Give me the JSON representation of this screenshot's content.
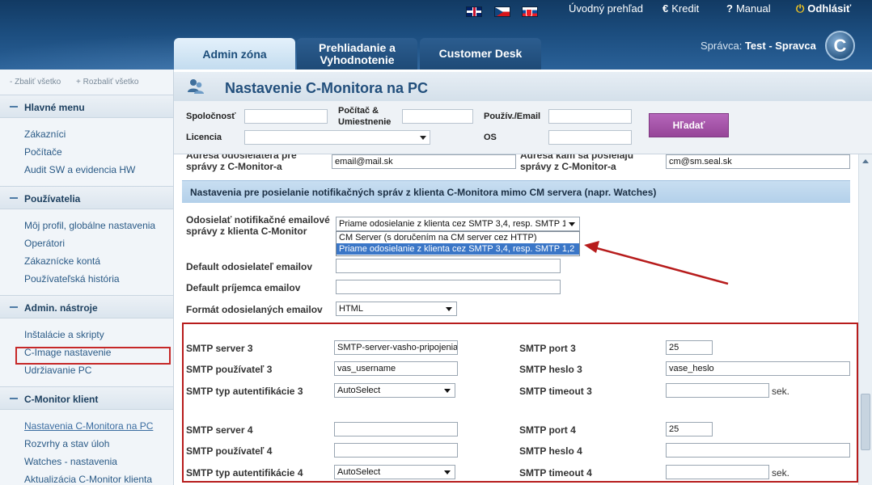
{
  "header": {
    "flags": [
      "en-flag",
      "cz-flag",
      "sk-flag"
    ],
    "links": {
      "home": "Úvodný prehľad",
      "credit": "Kredit",
      "manual": "Manual",
      "logout": "Odhlásiť"
    },
    "tabs": {
      "admin": "Admin zóna",
      "review": "Prehliadanie a Vyhodnotenie",
      "desk": "Customer Desk"
    },
    "admin_label": "Správca:",
    "admin_name": "Test - Spravca",
    "logo_letter": "C"
  },
  "sidebar": {
    "collapse_all": "- Zbaliť všetko",
    "expand_all": "+ Rozbaliť všetko",
    "groups": [
      {
        "title": "Hlavné menu",
        "items": [
          "Zákazníci",
          "Počítače",
          "Audit SW a evidencia HW"
        ]
      },
      {
        "title": "Používatelia",
        "items": [
          "Môj profil, globálne nastavenia",
          "Operátori",
          "Zákaznícke kontá",
          "Používateľská história"
        ]
      },
      {
        "title": "Admin. nástroje",
        "items": [
          "Inštalácie a skripty",
          "C-Image nastavenie",
          "Udržiavanie PC"
        ]
      },
      {
        "title": "C-Monitor klient",
        "items": [
          "Nastavenia C-Monitora na PC",
          "Rozvrhy a stav úloh",
          "Watches - nastavenia",
          "Aktualizácia C-Monitor klienta"
        ]
      }
    ],
    "active_item": "Nastavenia C-Monitora na PC"
  },
  "page": {
    "title": "Nastavenie C-Monitora na PC"
  },
  "filter": {
    "company_label": "Spoločnosť",
    "computer_label": "Počítač & Umiestnenie",
    "user_label": "Použív./Email",
    "license_label": "Licencia",
    "os_label": "OS",
    "search_button": "Hľadať"
  },
  "content": {
    "sender_addr_label": "Adresa odosielateľa pre správy z C-Monitor-a",
    "sender_addr_value": "email@mail.sk",
    "recipient_addr_label": "Adresa kam sa posielajú správy z C-Monitor-a",
    "recipient_addr_value": "cm@sm.seal.sk",
    "section_title": "Nastavenia pre posielanie notifikačných správ z klienta C-Monitora mimo CM servera (napr. Watches)",
    "send_label": "Odosielať notifikačné emailové správy z klienta C-Monitor",
    "send_selected": "Priame odosielanie z klienta cez SMTP 3,4, resp. SMTP 1,2",
    "send_options": [
      "CM Server (s doručením na CM server cez HTTP)",
      "Priame odosielanie z klienta cez SMTP 3,4, resp. SMTP 1,2"
    ],
    "default_sender_label": "Default odosielateľ emailov",
    "default_recipient_label": "Default príjemca emailov",
    "format_label": "Formát odosielaných emailov",
    "format_value": "HTML",
    "smtp3": {
      "server_label": "SMTP server 3",
      "server_value": "SMTP-server-vasho-pripojenia",
      "user_label": "SMTP používateľ 3",
      "user_value": "vas_username",
      "auth_label": "SMTP typ autentifikácie 3",
      "auth_value": "AutoSelect",
      "port_label": "SMTP port 3",
      "port_value": "25",
      "password_label": "SMTP heslo 3",
      "password_value": "vase_heslo",
      "timeout_label": "SMTP timeout 3",
      "timeout_value": "",
      "sec_unit": "sek."
    },
    "smtp4": {
      "server_label": "SMTP server 4",
      "server_value": "",
      "user_label": "SMTP používateľ 4",
      "user_value": "",
      "auth_label": "SMTP typ autentifikácie 4",
      "auth_value": "AutoSelect",
      "port_label": "SMTP port 4",
      "port_value": "25",
      "password_label": "SMTP heslo 4",
      "password_value": "",
      "timeout_label": "SMTP timeout 4",
      "timeout_value": "",
      "sec_unit": "sek."
    }
  },
  "colors": {
    "header_bg": "#1b4c7d",
    "section_bg": "#c8def1",
    "annotation_red": "#b71c1c",
    "search_button": "#a455a8",
    "selected_option": "#3a76c7"
  }
}
